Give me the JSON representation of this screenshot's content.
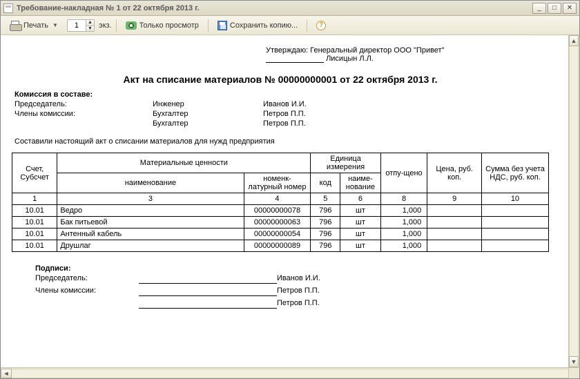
{
  "window": {
    "title": "Требование-накладная № 1 от 22 октября 2013 г."
  },
  "toolbar": {
    "print": "Печать",
    "copies_value": "1",
    "copies_unit": "экз.",
    "preview": "Только просмотр",
    "save_copy": "Сохранить копию...",
    "help": "?"
  },
  "approve": {
    "label": "Утверждаю:",
    "role": "Генеральный директор ООО \"Привет\"",
    "name": "Лисицын Л.Л."
  },
  "doc_title": "Акт на списание материалов № 00000000001 от 22 октября 2013 г.",
  "commission": {
    "heading": "Комиссия в составе:",
    "rows": [
      {
        "role": "Председатель:",
        "position": "Инженер",
        "name": "Иванов И.И."
      },
      {
        "role": "Члены комиссии:",
        "position": "Бухгалтер",
        "name": "Петров П.П."
      },
      {
        "role": "",
        "position": "Бухгалтер",
        "name": "Петров П.П."
      }
    ]
  },
  "intro": "Составили настоящий акт о списании материалов для нужд предприятия",
  "table": {
    "headers": {
      "account": "Счет, Субсчет",
      "materials": "Материальные ценности",
      "name": "наименование",
      "nomen": "номенк-латурный номер",
      "unit": "Единица измерения",
      "code": "код",
      "unit_name": "наиме-нование",
      "qty": "отпу-щено",
      "price": "Цена, руб. коп.",
      "sum": "Сумма без учета НДС, руб. коп."
    },
    "colnums": {
      "c1": "1",
      "c3": "3",
      "c4": "4",
      "c5": "5",
      "c6": "6",
      "c8": "8",
      "c9": "9",
      "c10": "10"
    },
    "rows": [
      {
        "acc": "10.01",
        "name": "Ведро",
        "nomen": "00000000078",
        "code": "796",
        "unit": "шт",
        "qty": "1,000",
        "price": "",
        "sum": ""
      },
      {
        "acc": "10.01",
        "name": "Бак питьевой",
        "nomen": "00000000063",
        "code": "796",
        "unit": "шт",
        "qty": "1,000",
        "price": "",
        "sum": ""
      },
      {
        "acc": "10.01",
        "name": "Антенный кабель",
        "nomen": "00000000054",
        "code": "796",
        "unit": "шт",
        "qty": "1,000",
        "price": "",
        "sum": ""
      },
      {
        "acc": "10.01",
        "name": "Друшлаг",
        "nomen": "00000000089",
        "code": "796",
        "unit": "шт",
        "qty": "1,000",
        "price": "",
        "sum": ""
      }
    ]
  },
  "signatures": {
    "heading": "Подписи:",
    "rows": [
      {
        "role": "Председатель:",
        "name": "Иванов И.И."
      },
      {
        "role": "Члены комиссии:",
        "name": "Петров П.П."
      },
      {
        "role": "",
        "name": "Петров П.П."
      }
    ]
  }
}
